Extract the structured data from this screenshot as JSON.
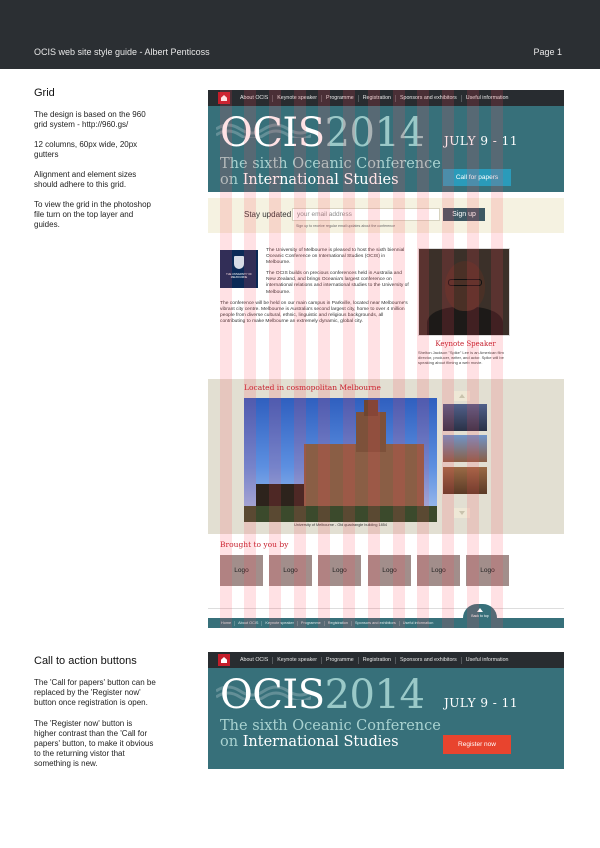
{
  "doc_header": {
    "title": "OCIS web site style guide - Albert Penticoss",
    "page": "Page 1"
  },
  "grid_section": {
    "heading": "Grid",
    "paragraphs": [
      "The design is based on the 960 grid system - http://960.gs/",
      "12 columns, 60px wide, 20px gutters",
      "Alignment and element sizes should adhere to this grid.",
      "To view the grid in the photoshop file turn on the top layer and guides."
    ]
  },
  "cta_section": {
    "heading": "Call to action buttons",
    "paragraphs": [
      "The 'Call for papers' button can be replaced by the 'Register now' button once registration is open.",
      "The 'Register now' button is higher contrast than the 'Call for papers' button, to make it obvious to the returning vistor that something is new."
    ]
  },
  "site": {
    "nav": [
      "About OCIS",
      "Keynote speaker",
      "Programme",
      "Registration",
      "Sponsors and exhibitors",
      "Useful information"
    ],
    "logo_main": "OCIS",
    "logo_year": "2014",
    "date": "JULY 9 - 11",
    "tagline_line1": "The sixth Oceanic Conference",
    "tagline_line2_prefix": "on",
    "tagline_line2_strong": "International Studies",
    "call_for_papers": "Call for papers",
    "register_now": "Register now",
    "subscribe": {
      "label": "Stay updated",
      "placeholder": "your email address",
      "hint": "Sign up to receive regular email updates about the conference",
      "button": "Sign up"
    },
    "uni_logo_text": "THE UNIVERSITY OF MELBOURNE",
    "intro": [
      "The University of Melbourne is pleased to host the sixth biennial Oceanic Conference on International Studies (OCIS) in Melbourne.",
      "The OCIS builds on precious conferences held in Australia and New Zealand, and brings Oceania's largest conference on international relations and international studies to the University of Melbourne.",
      "The conference will be held on our main campus in Parkville, located near Melbourne's vibrant city centre. Melbourne is Australia's second largest city, home to over 4 million people from diverse cultural, ethnic, linguistic and religious backgrounds, all contributing to make Melbourne an extremely dynamic, global city."
    ],
    "keynote": {
      "label": "Keynote Speaker",
      "bio": "Shelton Jackson \"Spike\" Lee is an American film director, producer, writer, and actor. Spike will be speaking about filming a web movie."
    },
    "gallery": {
      "heading": "Located in cosmopolitan Melbourne",
      "caption": "University of Melbourne - Old quadrangle building 1854"
    },
    "sponsors": {
      "heading": "Brought to you by",
      "logos": [
        "Logo",
        "Logo",
        "Logo",
        "Logo",
        "Logo",
        "Logo"
      ]
    },
    "back_to_top": "Back to top",
    "footer_nav": [
      "Home",
      "About OCIS",
      "Keynote speaker",
      "Programme",
      "Registration",
      "Sponsors and exhibitors",
      "Useful information"
    ]
  },
  "colors": {
    "header_bg": "#2b2f33",
    "hero_bg": "#37707a",
    "accent_red": "#c41e2b",
    "cta_blue": "#2a9bba",
    "cta_orange": "#e8442e",
    "grid_overlay": "#ff465a"
  }
}
